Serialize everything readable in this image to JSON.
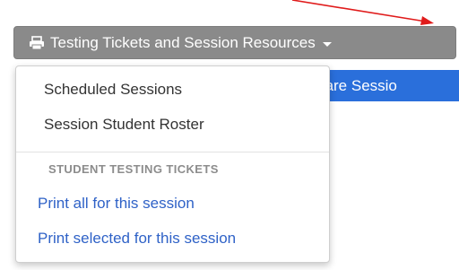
{
  "toggle": {
    "label": "Testing Tickets and Session Resources",
    "icon": "print-icon"
  },
  "background_button": {
    "label": "repare Sessio"
  },
  "menu": {
    "items": [
      {
        "label": "Scheduled Sessions"
      },
      {
        "label": "Session Student Roster"
      }
    ],
    "section_header": "STUDENT TESTING TICKETS",
    "links": [
      {
        "label": "Print all for this session"
      },
      {
        "label": "Print selected for this session"
      }
    ]
  },
  "colors": {
    "toggle_bg": "#8a8a8a",
    "link": "#2f62c7",
    "annotation": "#e01b1b",
    "primary_button": "#2a6fdb"
  }
}
